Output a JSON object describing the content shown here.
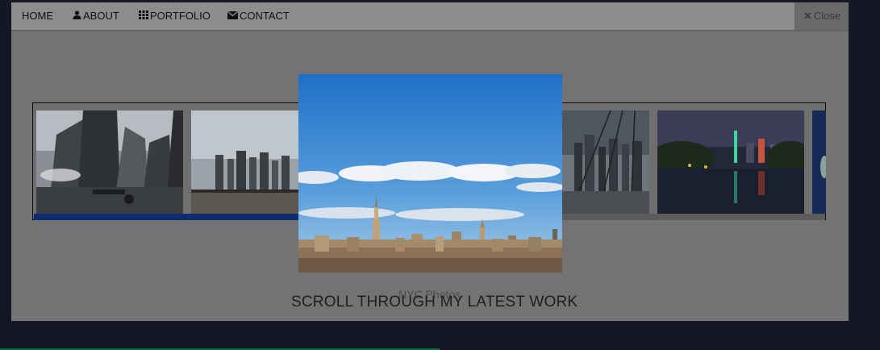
{
  "nav": {
    "items": [
      {
        "label": "HOME",
        "icon": ""
      },
      {
        "label": "ABOUT",
        "icon": "user-icon"
      },
      {
        "label": "PORTFOLIO",
        "icon": "grid-icon"
      },
      {
        "label": "CONTACT",
        "icon": "envelope-icon"
      }
    ],
    "close_label": "Close"
  },
  "gallery": {
    "caption": "NYC Photos",
    "heading": "SCROLL THROUGH MY LATEST WORK"
  },
  "colors": {
    "overlay": "#737373",
    "navbar": "#8d8d8d",
    "page_background": "#141824",
    "strip_indicator": "#0c2d6e",
    "sky": "#2f82d2"
  }
}
